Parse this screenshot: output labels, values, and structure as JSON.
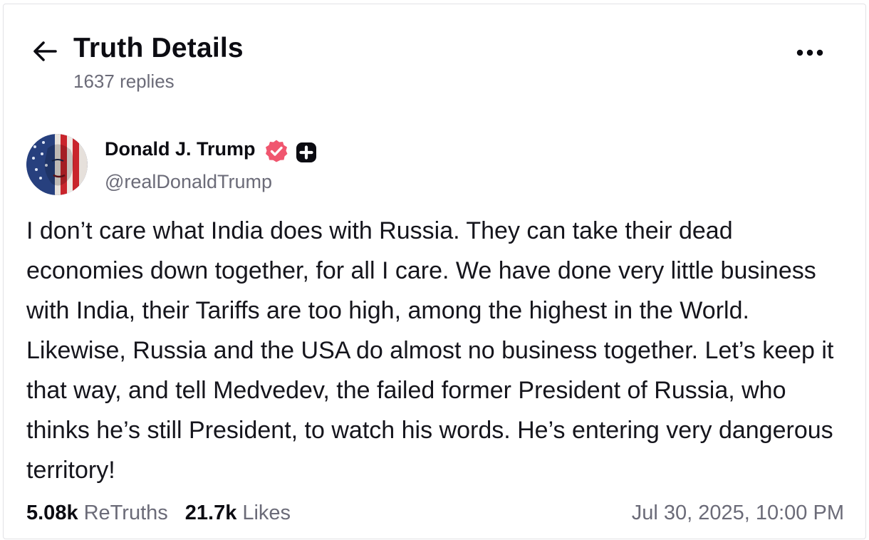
{
  "header": {
    "title": "Truth Details",
    "reply_count": "1637 replies",
    "back_icon": "arrow-left-icon",
    "more_icon": "more-horizontal-icon"
  },
  "post": {
    "author": {
      "name": "Donald J. Trump",
      "handle": "@realDonaldTrump",
      "verified_icon": "verified-check-icon",
      "plus_icon": "plus-badge-icon"
    },
    "body": "I don’t care what India does with Russia. They can take their dead economies down together, for all I care. We have done very little business with India, their Tariffs are too high, among the highest in the World. Likewise, Russia and the USA do almost no business together. Let’s keep it that way, and tell Medvedev, the failed former President of Russia, who thinks he’s still President, to watch his words. He’s entering very dangerous territory!",
    "stats": {
      "retruths_count": "5.08k",
      "retruths_label": "ReTruths",
      "likes_count": "21.7k",
      "likes_label": "Likes"
    },
    "timestamp": "Jul 30, 2025, 10:00 PM"
  },
  "colors": {
    "text_primary": "#0c0c12",
    "text_secondary": "#6b6b78",
    "verified_badge": "#f0566f",
    "border": "#e2e2e6"
  }
}
